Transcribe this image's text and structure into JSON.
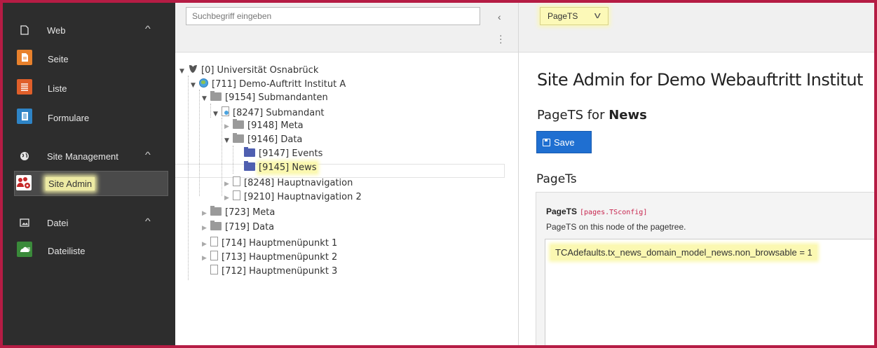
{
  "module_menu": {
    "groups": [
      {
        "label": "Web",
        "icon": "page-icon"
      },
      {
        "label": "Site Management",
        "icon": "globe-icon"
      },
      {
        "label": "Datei",
        "icon": "image-icon"
      }
    ],
    "items": [
      {
        "label": "Seite",
        "icon": "page-module-icon",
        "color": "#e8812c"
      },
      {
        "label": "Liste",
        "icon": "list-module-icon",
        "color": "#e05f2a"
      },
      {
        "label": "Formulare",
        "icon": "form-module-icon",
        "color": "#2e84c6"
      },
      {
        "label": "Site Admin",
        "icon": "site-admin-icon",
        "color": "#c62828"
      },
      {
        "label": "Dateiliste",
        "icon": "filelist-module-icon",
        "color": "#3a8a3a"
      }
    ],
    "chevron": "^"
  },
  "tree": {
    "search_placeholder": "Suchbegriff eingeben",
    "collapse_icon": "‹",
    "menu_icon": "⋮",
    "nodes": [
      "[0] Universität Osnabrück",
      "[711] Demo-Auftritt Institut A",
      "[9154] Submandanten",
      "[8247] Submandant",
      "[9148] Meta",
      "[9146] Data",
      "[9147] Events",
      "[9145] News",
      "[8248] Hauptnavigation",
      "[9210] Hauptnavigation 2",
      "[723] Meta",
      "[719] Data",
      "[714] Hauptmenüpunkt 1",
      "[713] Hauptmenüpunkt 2",
      "[712] Hauptmenüpunkt 3"
    ]
  },
  "content": {
    "dropdown_value": "PageTS",
    "page_title": "Site Admin for Demo Webauftritt Institut",
    "subtitle_prefix": "PageTS for ",
    "subtitle_bold": "News",
    "save_label": "Save",
    "section_title": "PageTs",
    "field_label": "PageTS",
    "field_code": "[pages.TSconfig]",
    "field_description": "PageTS on this node of the pagetree.",
    "field_value": "TCAdefaults.tx_news_domain_model_news.non_browsable = 1"
  },
  "colors": {
    "frame": "#b51c44",
    "sidebar": "#2d2d2d",
    "highlight": "#fbf8b0",
    "primary": "#1f6fd1"
  }
}
